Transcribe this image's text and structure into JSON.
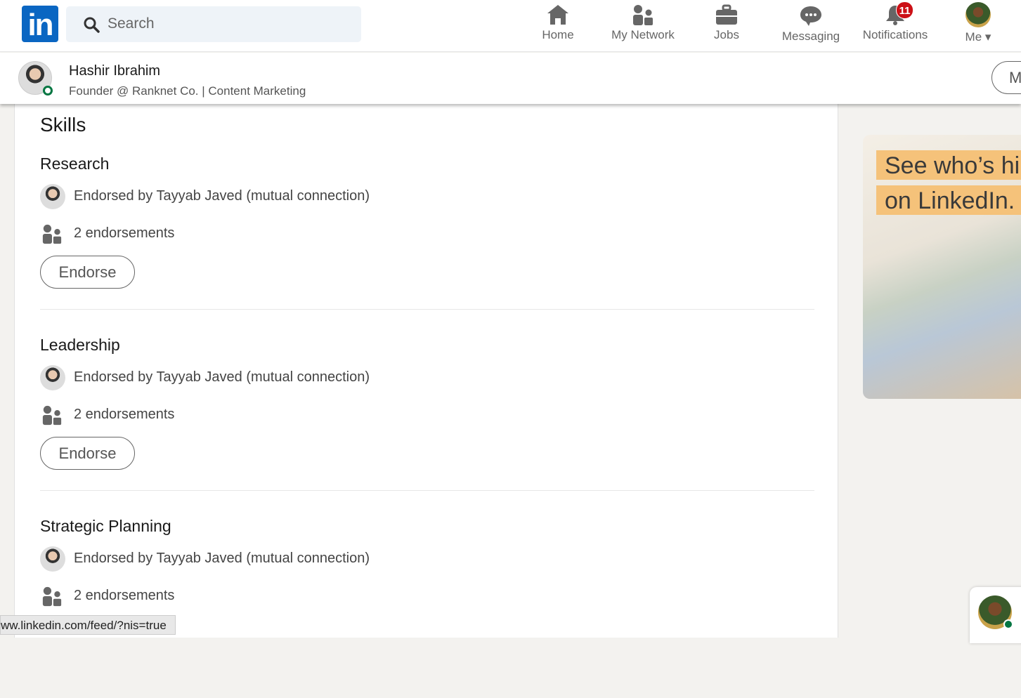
{
  "nav": {
    "logo": "in",
    "search_placeholder": "Search",
    "items": [
      {
        "label": "Home",
        "icon": "home-icon"
      },
      {
        "label": "My Network",
        "icon": "network-icon"
      },
      {
        "label": "Jobs",
        "icon": "briefcase-icon"
      },
      {
        "label": "Messaging",
        "icon": "chat-icon"
      },
      {
        "label": "Notifications",
        "icon": "bell-icon",
        "badge": "11"
      },
      {
        "label": "Me",
        "icon": "avatar"
      }
    ]
  },
  "profile": {
    "name": "Hashir Ibrahim",
    "headline": "Founder @ Ranknet Co. | Content Marketing",
    "more_button": "M"
  },
  "skills": {
    "title": "Skills",
    "items": [
      {
        "name": "Research",
        "endorsed_by": "Endorsed by Tayyab Javed (mutual connection)",
        "count": "2 endorsements",
        "button": "Endorse"
      },
      {
        "name": "Leadership",
        "endorsed_by": "Endorsed by Tayyab Javed (mutual connection)",
        "count": "2 endorsements",
        "button": "Endorse"
      },
      {
        "name": "Strategic Planning",
        "endorsed_by": "Endorsed by Tayyab Javed (mutual connection)",
        "count": "2 endorsements"
      }
    ]
  },
  "ad": {
    "line1": "See who’s hi",
    "line2": "on LinkedIn."
  },
  "status_url": "ww.linkedin.com/feed/?nis=true",
  "colors": {
    "brand": "#0a66c2",
    "badge": "#cc1016",
    "online": "#057642"
  }
}
